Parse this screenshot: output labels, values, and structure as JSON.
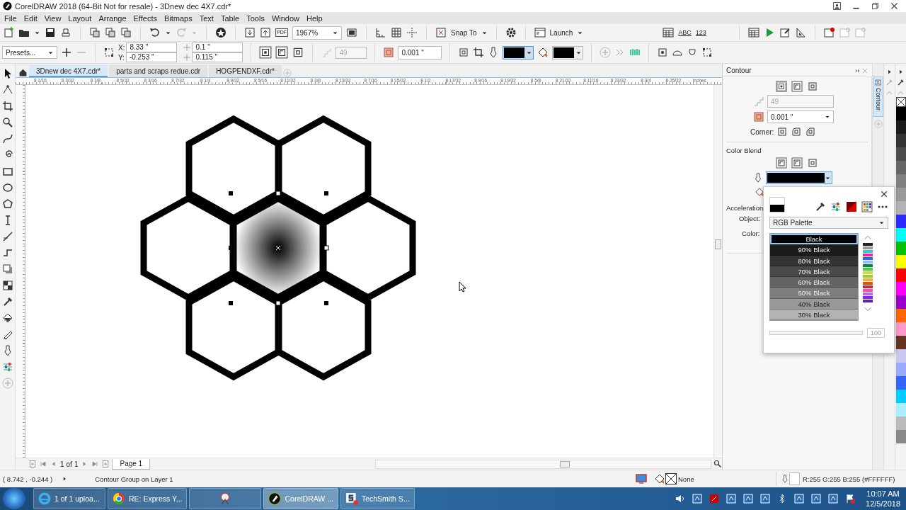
{
  "window": {
    "title": "CorelDRAW 2018 (64-Bit Not for resale) - 3Dnew dec 4X7.cdr*"
  },
  "menu": [
    "File",
    "Edit",
    "View",
    "Layout",
    "Arrange",
    "Effects",
    "Bitmaps",
    "Text",
    "Table",
    "Tools",
    "Window",
    "Help"
  ],
  "toolbar": {
    "pdf_label": "PDF",
    "zoom": "1967%",
    "snap_to": "Snap To",
    "launch": "Launch",
    "abc_label": "ABC",
    "num_label": "123"
  },
  "property_bar": {
    "presets": "Presets...",
    "x_label": "X:",
    "x": "8.33 \"",
    "y_label": "Y:",
    "y": "-0.253 \"",
    "width": "0.1 \"",
    "height": "0.115 \"",
    "steps": "49",
    "steps_disabled": true,
    "offset": "0.001 \""
  },
  "document_tabs": [
    {
      "label": "3Dnew dec 4X7.cdr*",
      "selected": true
    },
    {
      "label": "parts and scraps redue.cdr",
      "selected": false
    },
    {
      "label": "HOGPENDXF.cdr*",
      "selected": false
    }
  ],
  "ruler": {
    "labels": [
      "8 1/16",
      "8 3/32",
      "8 1/8",
      "8 5/32",
      "8 3/16",
      "8 7/32",
      "8 1/4",
      "8 9/32",
      "8 5/16",
      "8 11/32",
      "8 3/8",
      "8 13/32",
      "8 7/16",
      "8 15/32",
      "8 1/2",
      "8 17/32",
      "8 9/16",
      "8 19/32",
      "8 5/8",
      "8 21/32",
      "8 11/16",
      "8 23/32",
      "8 3/4",
      "8 25/32"
    ],
    "unit": "inches"
  },
  "docker": {
    "title": "Contour",
    "tab_label": "Contour",
    "steps": "49",
    "steps_disabled": true,
    "offset": "0.001 \"",
    "corner_label": "Corner:",
    "color_blend_label": "Color Blend",
    "acceleration_label": "Acceleration",
    "object_label": "Object:",
    "color_label": "Color:"
  },
  "color_popup": {
    "palette": "RGB Palette",
    "opacity": "100",
    "colors": [
      {
        "label": "Black",
        "color": "#000000",
        "selected": true
      },
      {
        "label": "90% Black",
        "color": "#1c1c1c",
        "selected": false
      },
      {
        "label": "80% Black",
        "color": "#333333",
        "selected": false
      },
      {
        "label": "70% Black",
        "color": "#4a4a4a",
        "selected": false
      },
      {
        "label": "60% Black",
        "color": "#636363",
        "selected": false
      },
      {
        "label": "50% Black",
        "color": "#7d7d7d",
        "selected": false
      },
      {
        "label": "40% Black",
        "color": "#999999",
        "selected": false
      },
      {
        "label": "30% Black",
        "color": "#b3b3b3",
        "selected": false
      }
    ]
  },
  "palette": {
    "swatches": [
      {
        "color": "#000000"
      },
      {
        "color": "#1a1a1a"
      },
      {
        "color": "#333333"
      },
      {
        "color": "#4d4d4d"
      },
      {
        "color": "#666666"
      },
      {
        "color": "#808080"
      },
      {
        "color": "#999999"
      },
      {
        "color": "#b3b3b3"
      },
      {
        "color": "#2b2bff"
      },
      {
        "color": "#00ffff"
      },
      {
        "color": "#00c000"
      },
      {
        "color": "#ffff00"
      },
      {
        "color": "#ff0000"
      },
      {
        "color": "#ff00ff"
      },
      {
        "color": "#9900cc"
      },
      {
        "color": "#ff6600"
      },
      {
        "color": "#ff99cc"
      },
      {
        "color": "#663322"
      },
      {
        "color": "#c8c8f0"
      },
      {
        "color": "#99aaff"
      },
      {
        "color": "#3366ff"
      },
      {
        "color": "#00ccff"
      },
      {
        "color": "#aaeeff"
      },
      {
        "color": "#bbbbbb"
      },
      {
        "color": "#888888"
      }
    ]
  },
  "page_nav": {
    "current": "1",
    "of": "of",
    "total": "1",
    "page_tab": "Page 1"
  },
  "status_bar": {
    "coordinates": "( 8.742 , -0.244 )",
    "selection_info": "Contour Group on Layer 1",
    "fill": "None",
    "outline": "R:255 G:255 B:255 (#FFFFFF)"
  },
  "taskbar": {
    "tasks": [
      {
        "label": "1 of 1 uploa...",
        "selected": false
      },
      {
        "label": "RE: Express Y...",
        "selected": false
      },
      {
        "selected": false
      },
      {
        "label": "CorelDRAW ...",
        "selected": true
      },
      {
        "label": "TechSmith S...",
        "selected": false
      }
    ],
    "time": "10:07 AM",
    "date": "12/5/2018"
  }
}
